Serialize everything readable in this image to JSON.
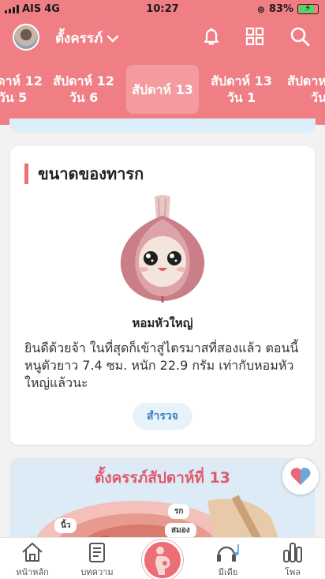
{
  "status_bar": {
    "carrier": "AIS",
    "network": "4G",
    "time": "10:27",
    "battery": "83%",
    "battery_level": 0.83
  },
  "header": {
    "profile_name": "ตั้งครรภ์",
    "tabs": [
      {
        "line1": "ัปดาห์ 12",
        "line2": "วัน 5"
      },
      {
        "line1": "สัปดาห์ 12",
        "line2": "วัน 6"
      },
      {
        "line1": "สัปดาห์ 13",
        "line2": ""
      },
      {
        "line1": "สัปดาห์ 13",
        "line2": "วัน 1"
      },
      {
        "line1": "สัปดาห",
        "line2": "วัน"
      }
    ],
    "active_tab": 2
  },
  "baby_size": {
    "title": "ขนาดของทารก",
    "fruit": "หอมหัวใหญ่",
    "description": "ยินดีด้วยจ้า ในที่สุดก็เข้าสู่ไตรมาสที่สองแล้ว ตอนนี้หนูตัวยาว 7.4 ซม. หนัก 22.9 กรัม เท่ากับหอมหัวใหญ่แล้วนะ",
    "explore_label": "สำรวจ"
  },
  "weekly_card": {
    "title": "ตั้งครรภ์สัปดาห์ที่ 13",
    "labels": {
      "umbilical": "รก",
      "placenta": "สมอง",
      "finger": "นิ้ว"
    }
  },
  "bottom_nav": {
    "items": [
      {
        "label": "หน้าหลัก",
        "icon": "home-icon"
      },
      {
        "label": "บทความ",
        "icon": "article-icon"
      },
      {
        "label": "มีเดีย",
        "icon": "media-icon"
      },
      {
        "label": "โพล",
        "icon": "poll-icon"
      }
    ]
  },
  "colors": {
    "brand": "#f07f85",
    "accent_text": "#3d7fc4",
    "card_title_bar": "#ec6f77"
  }
}
